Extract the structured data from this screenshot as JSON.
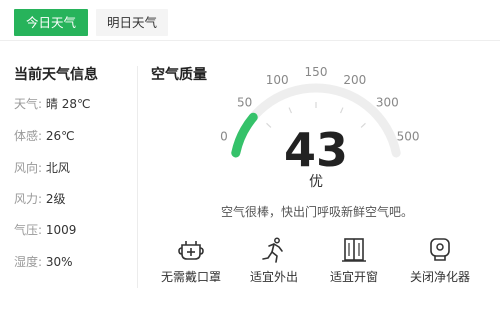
{
  "tabs": [
    {
      "label": "今日天气",
      "active": true
    },
    {
      "label": "明日天气",
      "active": false
    }
  ],
  "weather": {
    "title": "当前天气信息",
    "rows": [
      {
        "label": "天气:",
        "value": "晴 28℃"
      },
      {
        "label": "体感:",
        "value": "26℃"
      },
      {
        "label": "风向:",
        "value": "北风"
      },
      {
        "label": "风力:",
        "value": "2级"
      },
      {
        "label": "气压:",
        "value": "1009"
      },
      {
        "label": "湿度:",
        "value": "30%"
      }
    ]
  },
  "air_quality": {
    "title": "空气质量",
    "aqi": "43",
    "level": "优",
    "description": "空气很棒，快出门呼吸新鲜空气吧。",
    "scale_min": 0,
    "scale_max": 500,
    "scale_labels": [
      "0",
      "50",
      "100",
      "150",
      "200",
      "300",
      "500"
    ],
    "accent_color": "#35c26a",
    "track_color": "#eeeeee",
    "advice": [
      {
        "label": "无需戴口罩",
        "icon": "mask-icon"
      },
      {
        "label": "适宜外出",
        "icon": "running-person-icon"
      },
      {
        "label": "适宜开窗",
        "icon": "window-icon"
      },
      {
        "label": "关闭净化器",
        "icon": "air-purifier-icon"
      }
    ]
  }
}
